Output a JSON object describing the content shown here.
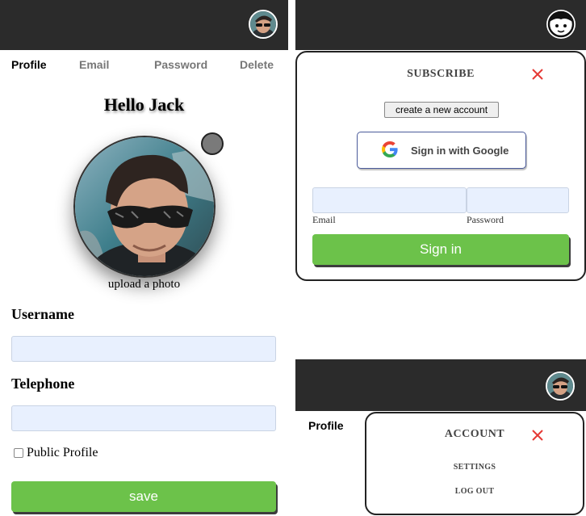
{
  "profile_screen": {
    "tabs": [
      {
        "label": "Profile",
        "active": true
      },
      {
        "label": "Email",
        "active": false
      },
      {
        "label": "Password",
        "active": false
      },
      {
        "label": "Delete",
        "active": false
      }
    ],
    "greeting": "Hello Jack",
    "upload_label": "upload a photo",
    "username_label": "Username",
    "username_value": "",
    "telephone_label": "Telephone",
    "telephone_value": "",
    "public_profile_label": "Public Profile",
    "public_profile_checked": false,
    "save_label": "save"
  },
  "subscribe_modal": {
    "title": "SUBSCRIBE",
    "create_account_label": "create a new account",
    "google_label": "Sign in with Google",
    "email_label": "Email",
    "email_value": "",
    "password_label": "Password",
    "password_value": "",
    "signin_label": "Sign in"
  },
  "account_menu": {
    "tab_label": "Profile",
    "title": "ACCOUNT",
    "items": [
      "SETTINGS",
      "LOG OUT"
    ]
  },
  "colors": {
    "topbar": "#2b2b2b",
    "primary_button": "#6cc24a",
    "input_fill": "#e8f0fe",
    "close_icon": "#e53935"
  },
  "icons": [
    "user-avatar-icon",
    "avatar-face-icon",
    "close-icon",
    "google-logo-icon",
    "checkbox-icon"
  ]
}
